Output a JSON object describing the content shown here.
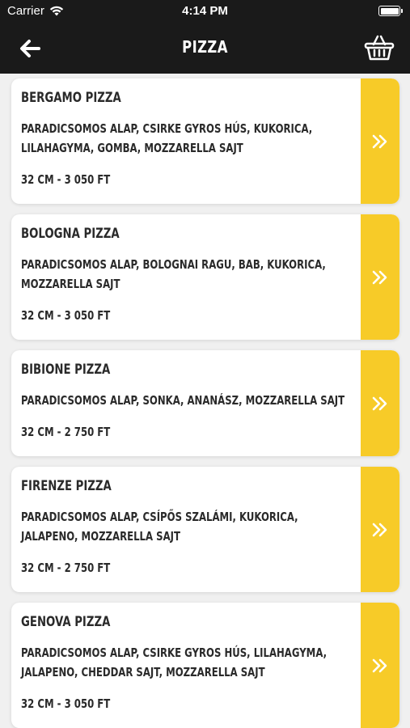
{
  "status": {
    "carrier": "Carrier",
    "time": "4:14 PM",
    "battery_level": 1.0
  },
  "header": {
    "title": "PIZZA",
    "back_icon": "back-arrow-icon",
    "cart_icon": "basket-icon"
  },
  "colors": {
    "header_bg": "#1a1a1a",
    "accent": "#f7cb28",
    "card_bg": "#ffffff",
    "text": "#2a2a2a"
  },
  "items": [
    {
      "name": "BERGAMO PIZZA",
      "description": "PARADICSOMOS ALAP, CSIRKE GYROS HÚS, KUKORICA, LILAHAGYMA, GOMBA, MOZZARELLA SAJT",
      "price": "32 CM - 3 050 FT"
    },
    {
      "name": "BOLOGNA PIZZA",
      "description": "PARADICSOMOS ALAP, BOLOGNAI RAGU, BAB, KUKORICA, MOZZARELLA SAJT",
      "price": "32 CM - 3 050 FT"
    },
    {
      "name": "BIBIONE PIZZA",
      "description": "PARADICSOMOS ALAP, SONKA, ANANÁSZ, MOZZARELLA SAJT",
      "price": "32 CM - 2 750 FT"
    },
    {
      "name": "FIRENZE PIZZA",
      "description": "PARADICSOMOS ALAP, CSÍPŐS SZALÁMI, KUKORICA, JALAPENO, MOZZARELLA SAJT",
      "price": "32 CM - 2 750 FT"
    },
    {
      "name": "GENOVA PIZZA",
      "description": "PARADICSOMOS ALAP, CSIRKE GYROS HÚS, LILAHAGYMA, JALAPENO, CHEDDAR SAJT, MOZZARELLA SAJT",
      "price": "32 CM - 3 050 FT"
    }
  ]
}
